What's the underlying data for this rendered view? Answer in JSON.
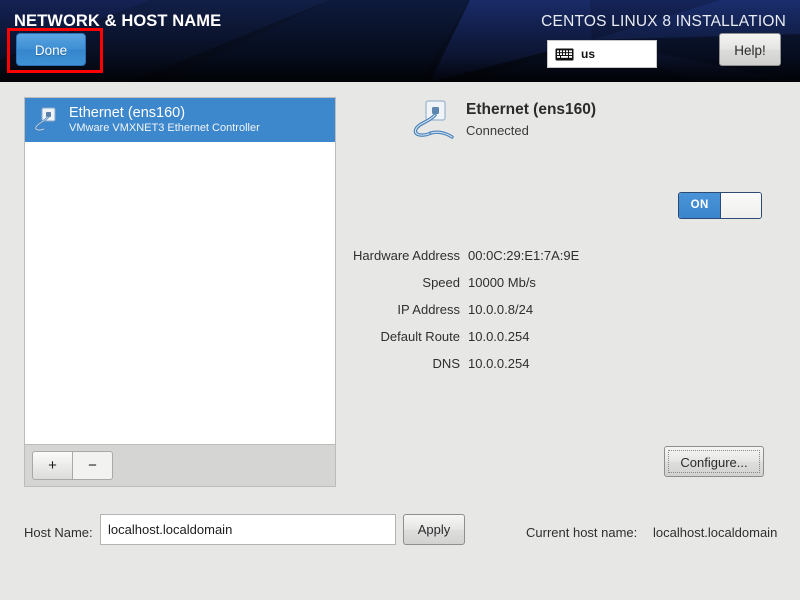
{
  "header": {
    "screen_title": "NETWORK & HOST NAME",
    "product_title": "CENTOS LINUX 8 INSTALLATION",
    "done_label": "Done",
    "help_label": "Help!",
    "keyboard_layout": "us",
    "keyboard_icon": "keyboard-icon",
    "annotation_color": "#ff0000",
    "accent_color": "#3d87cd"
  },
  "device_list": {
    "items": [
      {
        "name": "Ethernet (ens160)",
        "description": "VMware VMXNET3 Ethernet Controller",
        "icon": "wired-network-icon",
        "selected": true
      }
    ],
    "toolbar": {
      "add_label": "+",
      "remove_label": "−"
    }
  },
  "detail": {
    "icon": "wired-network-icon",
    "device_name": "Ethernet (ens160)",
    "connection_state": "Connected",
    "toggle": {
      "state_label": "ON",
      "value": true
    },
    "rows": [
      {
        "label": "Hardware Address",
        "value": "00:0C:29:E1:7A:9E"
      },
      {
        "label": "Speed",
        "value": "10000 Mb/s"
      },
      {
        "label": "IP Address",
        "value": "10.0.0.8/24"
      },
      {
        "label": "Default Route",
        "value": "10.0.0.254"
      },
      {
        "label": "DNS",
        "value": "10.0.0.254"
      }
    ],
    "configure_label": "Configure..."
  },
  "hostname": {
    "label": "Host Name:",
    "value": "localhost.localdomain",
    "placeholder": "localhost.localdomain",
    "apply_label": "Apply",
    "current_label": "Current host name:",
    "current_value": "localhost.localdomain"
  }
}
